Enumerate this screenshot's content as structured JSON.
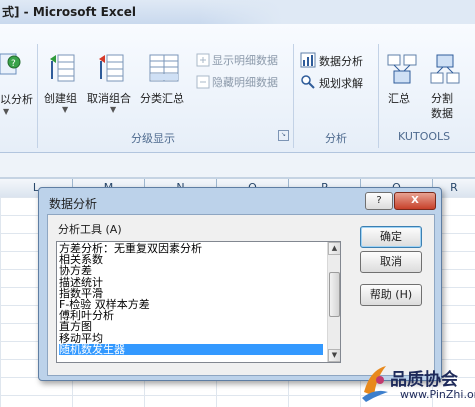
{
  "window": {
    "title": "式] - Microsoft Excel"
  },
  "ribbon": {
    "partial_label": "以分析",
    "outline": {
      "group_label": "分级显示",
      "buttons": [
        "创建组",
        "取消组合",
        "分类汇总"
      ],
      "show_detail": "显示明细数据",
      "hide_detail": "隐藏明细数据"
    },
    "analysis": {
      "group_label": "分析",
      "data_analysis": "数据分析",
      "solver": "规划求解"
    },
    "kutools": {
      "group_label": "KUTOOLS",
      "summary": "汇总",
      "split_line1": "分割",
      "split_line2": "数据"
    }
  },
  "sheet": {
    "columns": [
      "L",
      "M",
      "N",
      "O",
      "P",
      "Q",
      "R"
    ]
  },
  "dialog": {
    "title": "数据分析",
    "help_icon": "?",
    "close_icon": "X",
    "tools_label": "分析工具 (A)",
    "tools": [
      "方差分析：无重复双因素分析",
      "相关系数",
      "协方差",
      "描述统计",
      "指数平滑",
      "F-检验 双样本方差",
      "傅利叶分析",
      "直方图",
      "移动平均",
      "随机数发生器"
    ],
    "selected_index": 9,
    "ok": "确定",
    "cancel": "取消",
    "help": "帮助 (H)"
  },
  "watermark": {
    "name": "品质协会",
    "url": "www.PinZhi.org"
  },
  "colors": {
    "selection": "#3399ff",
    "dialog_frame": "#bcd2ea",
    "ribbon_label": "#4f6b8f"
  }
}
